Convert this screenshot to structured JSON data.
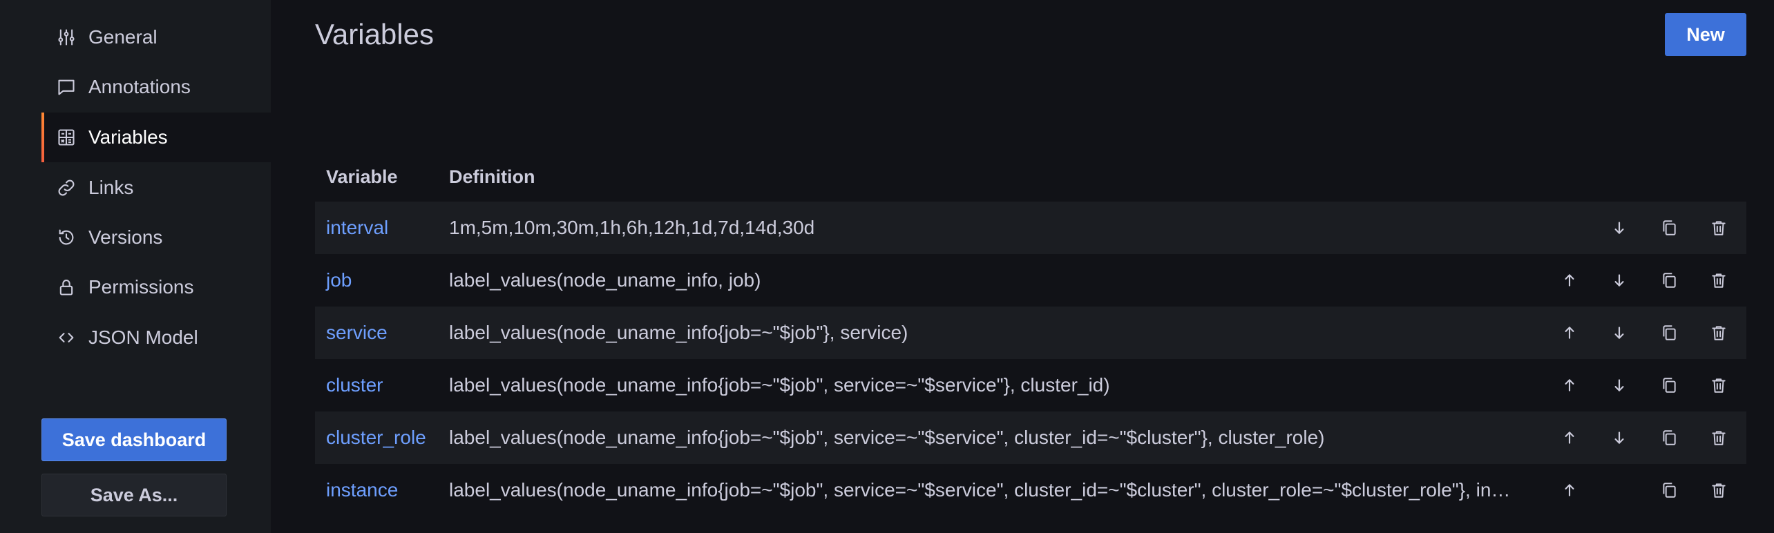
{
  "sidebar": {
    "items": [
      {
        "label": "General",
        "icon": "sliders-icon"
      },
      {
        "label": "Annotations",
        "icon": "comment-icon"
      },
      {
        "label": "Variables",
        "icon": "calculator-icon"
      },
      {
        "label": "Links",
        "icon": "link-icon"
      },
      {
        "label": "Versions",
        "icon": "history-icon"
      },
      {
        "label": "Permissions",
        "icon": "lock-icon"
      },
      {
        "label": "JSON Model",
        "icon": "code-icon"
      }
    ],
    "active": "Variables",
    "save_label": "Save dashboard",
    "save_as_label": "Save As..."
  },
  "main": {
    "title": "Variables",
    "new_label": "New",
    "columns": [
      "Variable",
      "Definition"
    ],
    "rows": [
      {
        "name": "interval",
        "definition": "1m,5m,10m,30m,1h,6h,12h,1d,7d,14d,30d"
      },
      {
        "name": "job",
        "definition": "label_values(node_uname_info, job)"
      },
      {
        "name": "service",
        "definition": "label_values(node_uname_info{job=~\"$job\"}, service)"
      },
      {
        "name": "cluster",
        "definition": "label_values(node_uname_info{job=~\"$job\", service=~\"$service\"}, cluster_id)"
      },
      {
        "name": "cluster_role",
        "definition": "label_values(node_uname_info{job=~\"$job\", service=~\"$service\", cluster_id=~\"$cluster\"}, cluster_role)"
      },
      {
        "name": "instance",
        "definition": "label_values(node_uname_info{job=~\"$job\", service=~\"$service\", cluster_id=~\"$cluster\", cluster_role=~\"$cluster_role\"}, instance)"
      }
    ]
  },
  "colors": {
    "accent": "#3d71d9",
    "link": "#6e9fff",
    "active_indicator": "#ff8833"
  }
}
